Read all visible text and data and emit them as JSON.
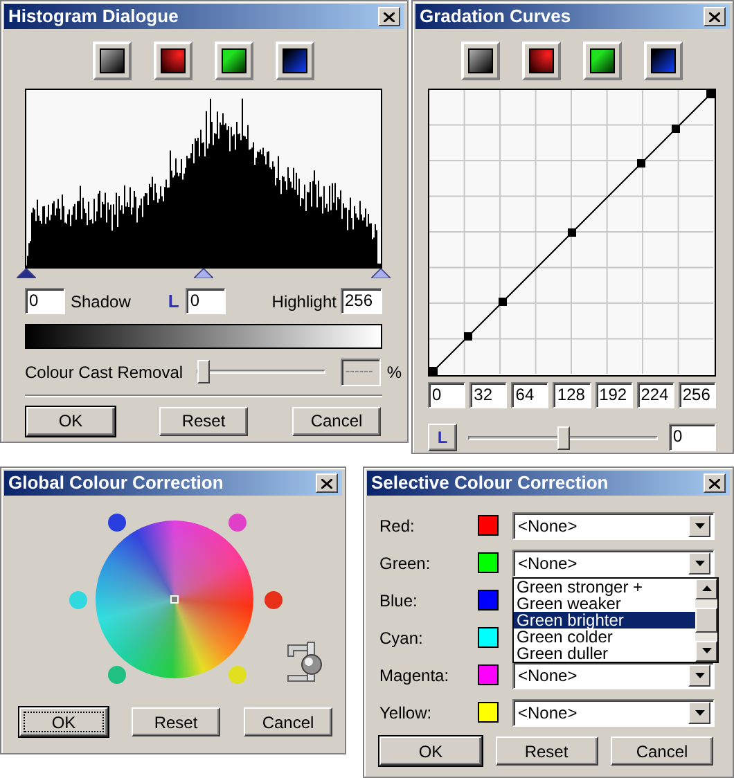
{
  "histogram_dialog": {
    "title": "Histogram Dialogue",
    "channel_buttons": [
      {
        "kind": "grey"
      },
      {
        "kind": "red"
      },
      {
        "kind": "green"
      },
      {
        "kind": "blue"
      }
    ],
    "markers": [
      {
        "selected": true
      },
      {
        "selected": false
      },
      {
        "selected": false
      }
    ],
    "shadow_value": "0",
    "shadow_label": "Shadow",
    "mode_glyph": "L",
    "mid_value": "0",
    "highlight_label": "Highlight",
    "highlight_value": "256",
    "colour_cast": {
      "label": "Colour Cast Removal",
      "level": 0,
      "placeholder": "------",
      "disabled": true,
      "unit": "%"
    },
    "buttons": [
      {
        "label": "OK",
        "default": true
      },
      {
        "label": "Reset",
        "default": false
      },
      {
        "label": "Cancel",
        "default": false
      }
    ]
  },
  "gradation_curves": {
    "title": "Gradation Curves",
    "channel_buttons": [
      {
        "kind": "grey"
      },
      {
        "kind": "red"
      },
      {
        "kind": "green"
      },
      {
        "kind": "blue"
      }
    ],
    "values": [
      "0",
      "32",
      "64",
      "128",
      "192",
      "224",
      "256"
    ],
    "mode_button": "L",
    "slider": {
      "level": 0.5
    },
    "slider_value": "0"
  },
  "global_colour_correction": {
    "title": "Global Colour Correction",
    "dots": [
      {
        "color": "#2a3ee0"
      },
      {
        "color": "#e040c8"
      },
      {
        "color": "#30d8e0"
      },
      {
        "color": "#e83018"
      },
      {
        "color": "#20c080"
      },
      {
        "color": "#e0e020"
      }
    ],
    "buttons": [
      {
        "label": "OK",
        "default": true,
        "focused": true
      },
      {
        "label": "Reset",
        "default": false,
        "focused": false
      },
      {
        "label": "Cancel",
        "default": false,
        "focused": false
      }
    ]
  },
  "selective_colour_correction": {
    "title": "Selective Colour Correction",
    "rows": [
      {
        "label": "Red:",
        "color": "#ff0000",
        "value": "<None>"
      },
      {
        "label": "Green:",
        "color": "#00ff00",
        "value": "<None>",
        "open": true,
        "options": [
          {
            "label": "Green stronger +",
            "selected": false
          },
          {
            "label": "Green weaker",
            "selected": false
          },
          {
            "label": "Green brighter",
            "selected": true
          },
          {
            "label": "Green colder",
            "selected": false
          },
          {
            "label": "Green duller",
            "selected": false
          }
        ]
      },
      {
        "label": "Blue:",
        "color": "#0000ff"
      },
      {
        "label": "Cyan:",
        "color": "#00ffff"
      },
      {
        "label": "Magenta:",
        "color": "#ff00ff",
        "value": "<None>"
      },
      {
        "label": "Yellow:",
        "color": "#ffff00",
        "value": "<None>"
      }
    ],
    "buttons": [
      {
        "label": "OK",
        "default": true
      },
      {
        "label": "Reset",
        "default": false
      },
      {
        "label": "Cancel",
        "default": false
      }
    ]
  }
}
